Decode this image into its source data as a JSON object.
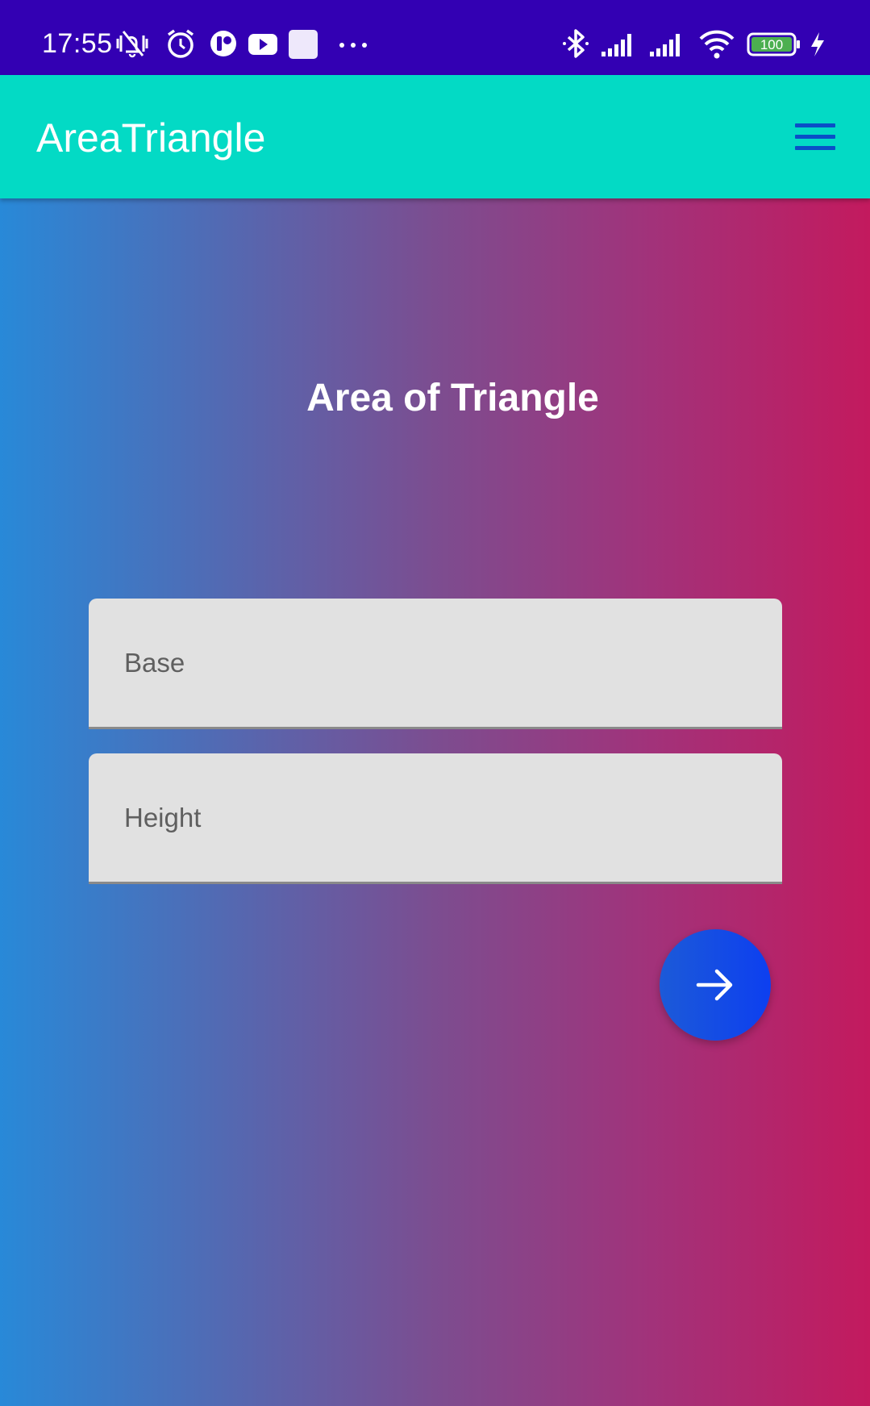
{
  "status_bar": {
    "time": "17:55",
    "battery_level": "100",
    "icons": [
      "vibrate-mute-icon",
      "alarm-icon",
      "app-icon",
      "youtube-icon",
      "square-icon",
      "more-icon",
      "bluetooth-icon",
      "signal-icon",
      "signal-icon",
      "wifi-icon",
      "battery-icon",
      "charging-icon"
    ],
    "background_color": "#3300b3"
  },
  "app_bar": {
    "title": "AreaTriangle",
    "menu_icon": "hamburger-menu-icon",
    "background_color": "#03dac5",
    "menu_icon_color": "#0a4fc7"
  },
  "main": {
    "heading": "Area of Triangle",
    "base_field": {
      "value": "",
      "placeholder": "Base"
    },
    "height_field": {
      "value": "",
      "placeholder": "Height"
    },
    "submit_icon": "arrow-right-icon",
    "gradient_colors": [
      "#2889d8",
      "#c31a5e"
    ],
    "fab_color": "#0d3ff0"
  }
}
